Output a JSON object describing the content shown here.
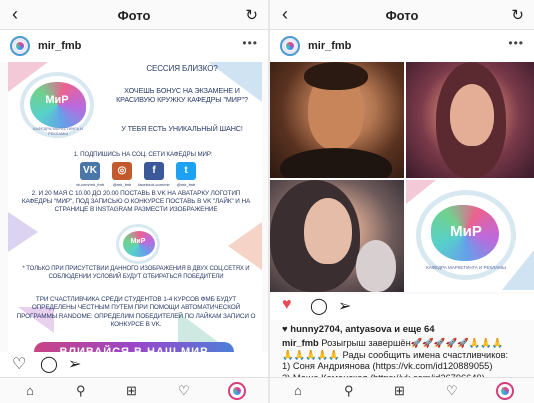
{
  "left": {
    "header": {
      "title": "Фото",
      "back_icon": "‹",
      "refresh_icon": "↻"
    },
    "post": {
      "username": "mir_fmb",
      "more": "•••"
    },
    "poster": {
      "logo_text": "МиР",
      "logo_caption": "КАФЕДРА МАРКЕТИНГА И РЕКЛАМЫ",
      "line1": "Сессия близко?",
      "line2": "Хочешь бонус на экзамене и красивую кружку кафедры \"МиР\"?",
      "line3": "У тебя есть уникальный шанс!",
      "step1": "1. Подпишись на соц. сети кафедры МиР:",
      "socials": [
        {
          "label": "VK",
          "caption": "vk.com/mir_fmb",
          "color": "#4a76a8"
        },
        {
          "label": "◎",
          "caption": "@mir_fmb",
          "color": "#c35a2d"
        },
        {
          "label": "f",
          "caption": "facebook.com/mir",
          "color": "#3b5998"
        },
        {
          "label": "t",
          "caption": "@mir_fmb",
          "color": "#1da1f2"
        }
      ],
      "step2": "2. И 20 мая с 10.00 до 20.00 поставь в VK на аватарку логотип кафедры \"МиР\", под записью о конкурсе поставь в VK \"лайк\" и на странице в Instagram размести изображение",
      "note": "* Только при присутствии данного изображения в двух соц.сетях и соблюдении условий будут отбираться победители",
      "footer": "Три счастливчика среди студентов 1-4 курсов ФМБ будут определены честным путем при помощи автоматической программы Randome: определим победителей по лайкам записи о конкурсе в VK.",
      "banner": "ВЛИВАЙСЯ В НАШ МИР"
    }
  },
  "right": {
    "header": {
      "title": "Фото",
      "back_icon": "‹",
      "refresh_icon": "↻"
    },
    "post": {
      "username": "mir_fmb",
      "more": "•••"
    },
    "logo_text": "МиР",
    "logo_caption": "КАФЕДРА МАРКЕТИНГА И РЕКЛАМЫ",
    "likes_text": "hunny2704, antyasova и еще 64",
    "caption_user": "mir_fmb",
    "caption_line1": " Розыгрыш завершён🚀🚀🚀🚀🚀🙏🙏🙏",
    "caption_line2": "🙏🙏🙏🙏🙏 Рады сообщить имена счастливчиков:",
    "caption_line3": "1) Соня Андриянова (https://vk.com/id120889055)",
    "caption_line4": "2) Маша Каменская (https://vk.com/id36796640)"
  },
  "icons": {
    "like": "heart-icon",
    "comment": "comment-icon",
    "share": "send-icon",
    "home": "home-icon",
    "search": "search-icon",
    "add": "add-icon",
    "activity": "heart-outline-icon",
    "profile": "profile-icon"
  },
  "colors": {
    "like_red": "#ed4956",
    "accent_blue": "#4a9bd0"
  }
}
